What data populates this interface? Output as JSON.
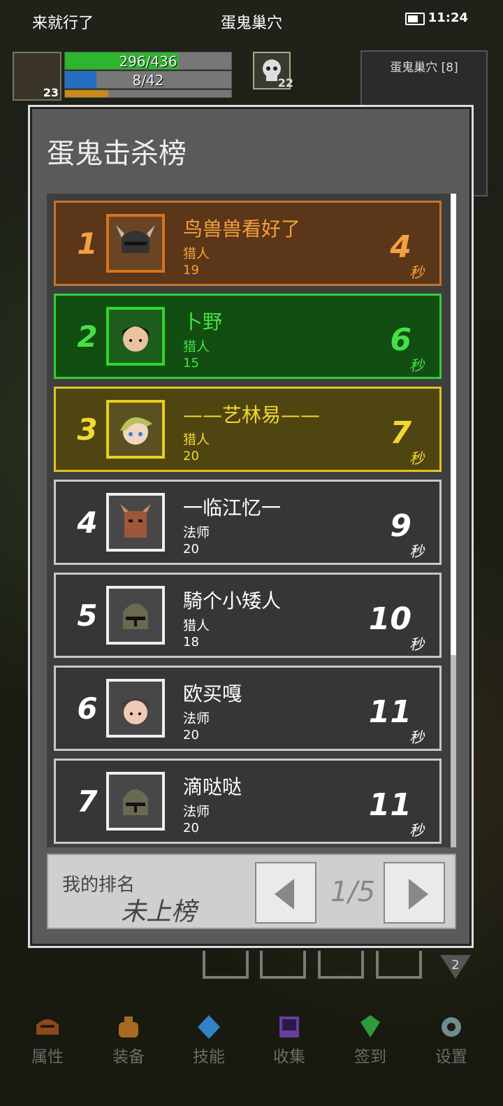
{
  "status_bar": {
    "left": "来就行了",
    "title": "蛋鬼巢穴",
    "time": "11:24"
  },
  "hud": {
    "player_level": "23",
    "hp": {
      "text": "296/436",
      "ratio": 0.679,
      "color": "#2db52d"
    },
    "mp": {
      "text": "8/42",
      "ratio": 0.19,
      "color": "#2470c0"
    },
    "xp_ratio": 0.26,
    "enemy_level": "22",
    "minimap_title": "蛋鬼巢穴 [8]"
  },
  "panel": {
    "title": "蛋鬼击杀榜",
    "sec_unit": "秒"
  },
  "entries": [
    {
      "rank": "1",
      "name": "鸟兽兽看好了",
      "job": "猎人",
      "level": "19",
      "seconds": "4",
      "style": "gold",
      "avatar_icon": "horned-helmet-icon"
    },
    {
      "rank": "2",
      "name": "卜野",
      "job": "猎人",
      "level": "15",
      "seconds": "6",
      "style": "green",
      "avatar_icon": "black-hair-boy-icon"
    },
    {
      "rank": "3",
      "name": "——艺林易——",
      "job": "猎人",
      "level": "20",
      "seconds": "7",
      "style": "yellow",
      "avatar_icon": "blond-hair-girl-icon"
    },
    {
      "rank": "4",
      "name": "一临江忆一",
      "job": "法师",
      "level": "20",
      "seconds": "9",
      "style": "gray",
      "avatar_icon": "horned-mask-icon"
    },
    {
      "rank": "5",
      "name": "騎个小矮人",
      "job": "猎人",
      "level": "18",
      "seconds": "10",
      "style": "gray",
      "avatar_icon": "knight-helmet-icon"
    },
    {
      "rank": "6",
      "name": "欧买嘎",
      "job": "法师",
      "level": "20",
      "seconds": "11",
      "style": "gray",
      "avatar_icon": "helmet-boy-icon"
    },
    {
      "rank": "7",
      "name": "滴哒哒",
      "job": "法师",
      "level": "20",
      "seconds": "11",
      "style": "gray",
      "avatar_icon": "knight-helmet-icon"
    }
  ],
  "my_rank": {
    "label": "我的排名",
    "value": "未上榜"
  },
  "pagination": {
    "text": "1/5"
  },
  "slots_badge": "2",
  "tabbar": [
    {
      "label": "属性",
      "icon": "helmet-icon",
      "color": "#8a4a1e"
    },
    {
      "label": "装备",
      "icon": "bag-icon",
      "color": "#a66a22"
    },
    {
      "label": "技能",
      "icon": "crystal-icon",
      "color": "#2e84c2"
    },
    {
      "label": "收集",
      "icon": "book-icon",
      "color": "#6a3ca2"
    },
    {
      "label": "签到",
      "icon": "gem-icon",
      "color": "#2e9a3a"
    },
    {
      "label": "设置",
      "icon": "gear-icon",
      "color": "#6f8c8f"
    }
  ]
}
